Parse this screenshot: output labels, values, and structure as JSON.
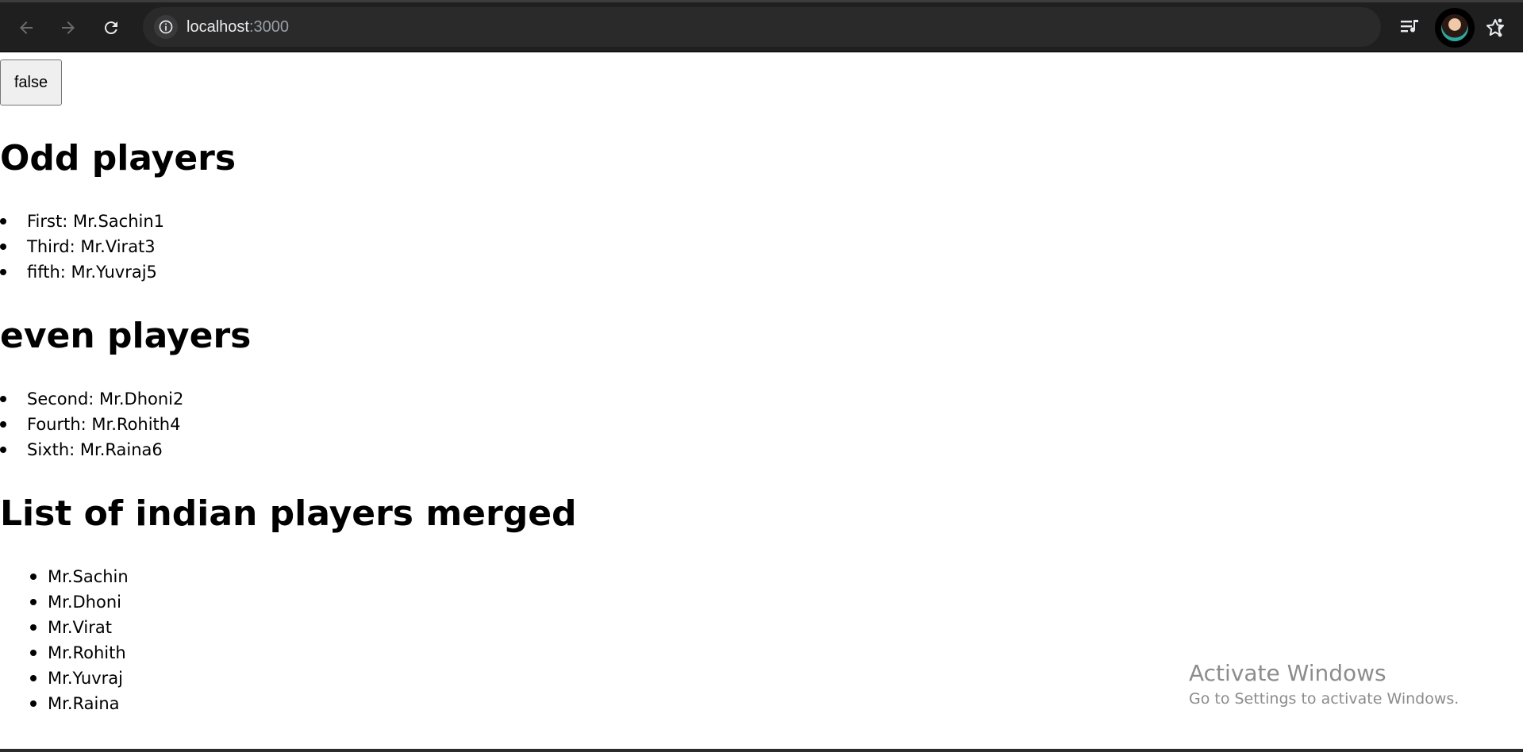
{
  "browser": {
    "url_host": "localhost",
    "url_port": ":3000"
  },
  "page": {
    "toggle_label": "false",
    "sections": [
      {
        "heading": "Odd players",
        "items": [
          "First: Mr.Sachin1",
          "Third: Mr.Virat3",
          "fifth: Mr.Yuvraj5"
        ]
      },
      {
        "heading": "even players",
        "items": [
          "Second: Mr.Dhoni2",
          "Fourth: Mr.Rohith4",
          "Sixth: Mr.Raina6"
        ]
      },
      {
        "heading": "List of indian players merged",
        "items": [
          "Mr.Sachin",
          "Mr.Dhoni",
          "Mr.Virat",
          "Mr.Rohith",
          "Mr.Yuvraj",
          "Mr.Raina"
        ]
      }
    ]
  },
  "watermark": {
    "title": "Activate Windows",
    "subtitle": "Go to Settings to activate Windows."
  },
  "icons": {
    "back": "arrow-left-icon",
    "forward": "arrow-right-icon",
    "reload": "reload-icon",
    "site_info": "info-icon",
    "install": "install-app-icon",
    "bookmark": "star-icon",
    "media": "media-controls-icon",
    "menu": "more-vert-icon"
  },
  "colors": {
    "toolbar_bg": "#1f1f1f",
    "omnibox_bg": "#2a2a2a",
    "page_bg": "#ffffff",
    "text": "#000000",
    "watermark_text": "#8c8c8c"
  }
}
